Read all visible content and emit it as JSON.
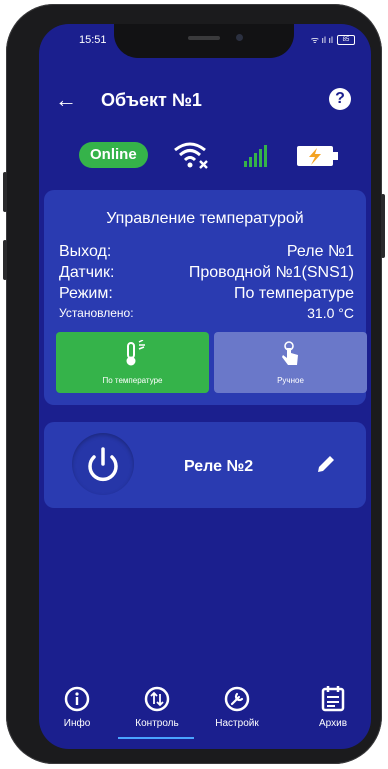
{
  "status_bar": {
    "time": "15:51",
    "signal_text": "ᯤ ıl ıl",
    "battery_text": "85"
  },
  "app_bar": {
    "back_icon": "arrow-left-icon",
    "title": "Объект №1",
    "help_icon": "help-icon"
  },
  "connection": {
    "online_label": "Online",
    "wifi_icon": "wifi-off-icon",
    "cell_icon": "cellular-signal-icon",
    "battery_icon": "battery-charging-icon"
  },
  "temperature_card": {
    "title": "Управление температурой",
    "rows": [
      {
        "key": "Выход:",
        "value": "Реле №1"
      },
      {
        "key": "Датчик:",
        "value": "Проводной №1(SNS1)"
      },
      {
        "key": "Режим:",
        "value": "По температуре"
      },
      {
        "key": "Установлено:",
        "value": "31.0 °C"
      }
    ],
    "mode_auto_label": "По температуре",
    "mode_manual_label": "Ручное"
  },
  "relay_card": {
    "power_icon": "power-icon",
    "name": "Реле №2",
    "edit_icon": "pencil-icon"
  },
  "bottom_nav": [
    {
      "label": "Инфо",
      "icon": "info-icon"
    },
    {
      "label": "Контроль",
      "icon": "control-icon"
    },
    {
      "label": "Настройк",
      "icon": "wrench-icon"
    },
    {
      "label": "Архив",
      "icon": "archive-icon"
    }
  ],
  "colors": {
    "background": "#1b1f8e",
    "card": "#2a3bb1",
    "online": "#35b34a",
    "manual": "#6a78c9",
    "accent": "#4aa3ff"
  }
}
